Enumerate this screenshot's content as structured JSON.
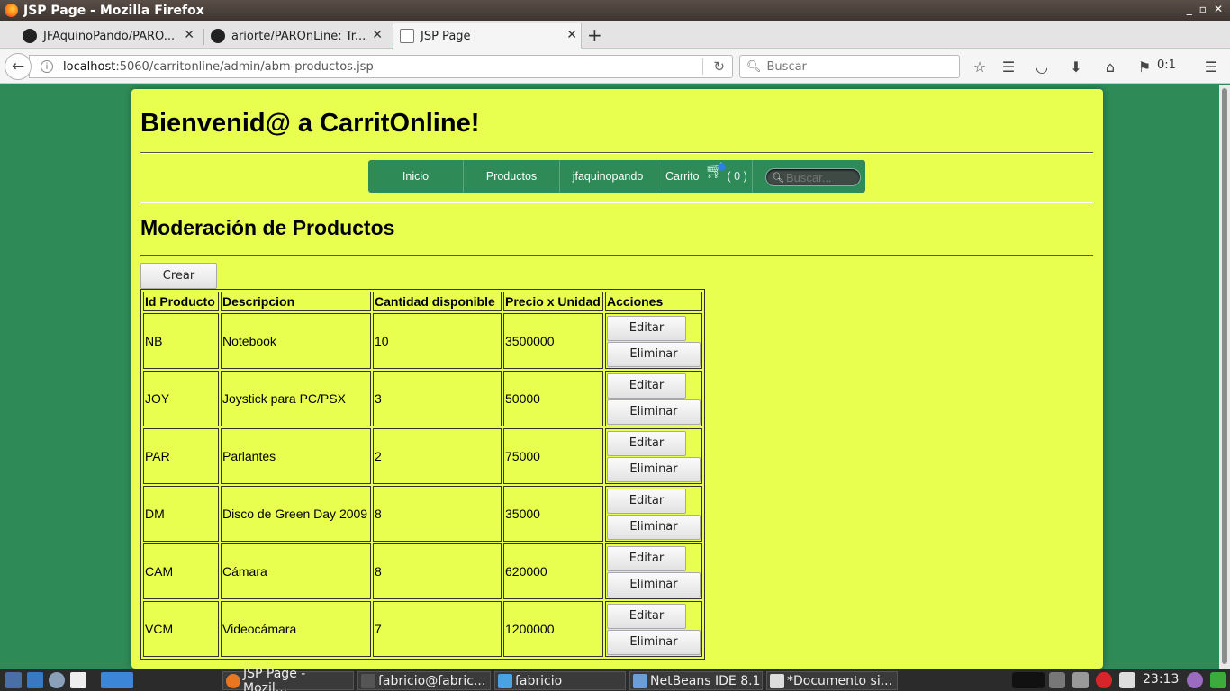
{
  "window": {
    "title": "JSP Page - Mozilla Firefox"
  },
  "tabs": [
    {
      "label": "JFAquinoPando/PARO...",
      "icon": "github-icon"
    },
    {
      "label": "ariorte/PAROnLine: Tr...",
      "icon": "github-icon"
    },
    {
      "label": "JSP Page",
      "icon": "page-icon"
    }
  ],
  "nav": {
    "url_host": "localhost",
    "url_rest": ":5060/carritonline/admin/abm-productos.jsp",
    "search_placeholder": "Buscar",
    "counter": "0:1"
  },
  "page": {
    "heading": "Bienvenid@ a CarritOnline!",
    "menu": {
      "inicio": "Inicio",
      "productos": "Productos",
      "user": "jfaquinopando",
      "cart_label": "Carrito",
      "cart_count": "( 0 )",
      "search_placeholder": "Buscar..."
    },
    "section_title": "Moderación de Productos",
    "create_button": "Crear",
    "table": {
      "headers": [
        "Id Producto",
        "Descripcion",
        "Cantidad disponible",
        "Precio x Unidad",
        "Acciones"
      ],
      "rows": [
        {
          "id": "NB",
          "desc": "Notebook",
          "qty": "10",
          "price": "3500000"
        },
        {
          "id": "JOY",
          "desc": "Joystick para PC/PSX",
          "qty": "3",
          "price": "50000"
        },
        {
          "id": "PAR",
          "desc": "Parlantes",
          "qty": "2",
          "price": "75000"
        },
        {
          "id": "DM",
          "desc": "Disco de Green Day 2009",
          "qty": "8",
          "price": "35000"
        },
        {
          "id": "CAM",
          "desc": "Cámara",
          "qty": "8",
          "price": "620000"
        },
        {
          "id": "VCM",
          "desc": "Videocámara",
          "qty": "7",
          "price": "1200000"
        }
      ],
      "edit_label": "Editar",
      "delete_label": "Eliminar"
    }
  },
  "taskbar": {
    "tasks": [
      "JSP Page - Mozil...",
      "fabricio@fabric...",
      "fabricio",
      "NetBeans IDE 8.1",
      "*Documento si..."
    ],
    "clock": "23:13"
  },
  "colors": {
    "page_bg": "#2e8b57",
    "panel_bg": "#e9ff50",
    "menu_bg": "#2e8b57"
  }
}
